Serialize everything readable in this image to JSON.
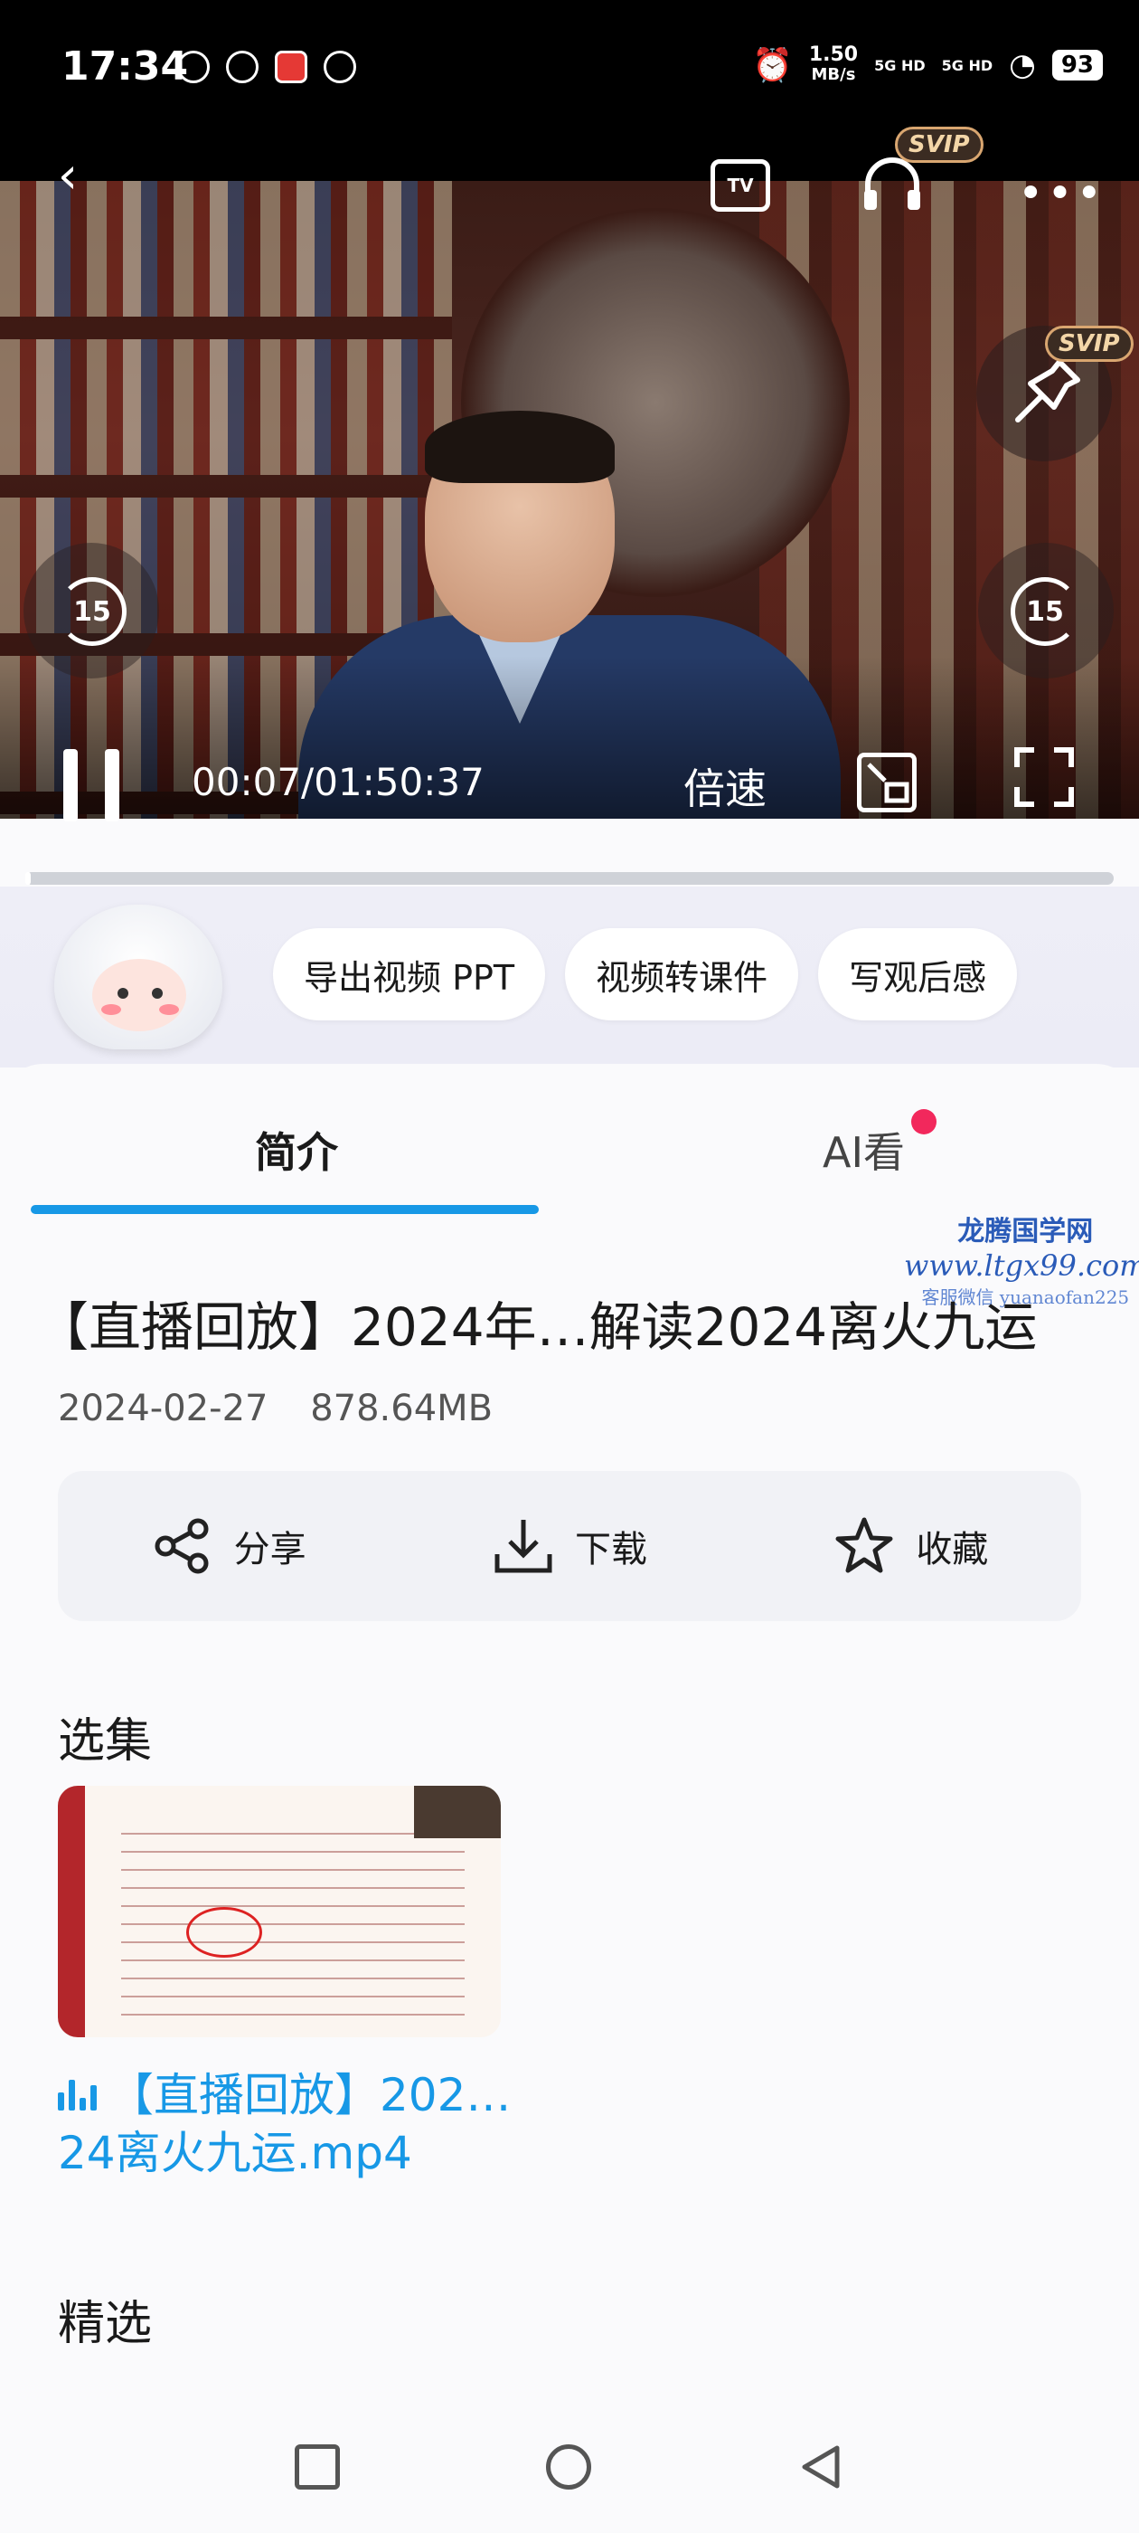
{
  "status_bar": {
    "time": "17:34",
    "net_speed_value": "1.50",
    "net_speed_unit": "MB/s",
    "signal_1": "5G HD",
    "signal_2": "5G HD",
    "battery": "93"
  },
  "player": {
    "timecode": "00:07/01:50:37",
    "speed_label": "倍速",
    "skip_back": "15",
    "skip_forward": "15",
    "svip_badge": "SVIP",
    "progress_fraction": 0.001,
    "icons": [
      "back-icon",
      "tv-cast-icon",
      "headphones-icon",
      "more-icon",
      "pin-icon",
      "skip-back-icon",
      "skip-forward-icon",
      "pause-icon",
      "pip-icon",
      "fullscreen-icon"
    ]
  },
  "ai_tools": {
    "pills": [
      "导出视频 PPT",
      "视频转课件",
      "写观后感"
    ]
  },
  "tabs": {
    "intro": "简介",
    "ai": "AI看"
  },
  "watermark": {
    "line1": "龙腾国学网",
    "line2": "www.ltgx99.com",
    "line3": "客服微信 yuanaofan225"
  },
  "video_info": {
    "title": "【直播回放】2024年…解读2024离火九运",
    "date": "2024-02-27",
    "size": "878.64MB"
  },
  "actions": {
    "share": "分享",
    "download": "下载",
    "favorite": "收藏"
  },
  "episodes": {
    "heading": "选集",
    "item_label": "【直播回放】202…24离火九运.mp4"
  },
  "featured": {
    "heading": "精选"
  },
  "colors": {
    "accent": "#1798e6",
    "tab_dot": "#f2285c",
    "svip": "#d9a670"
  }
}
